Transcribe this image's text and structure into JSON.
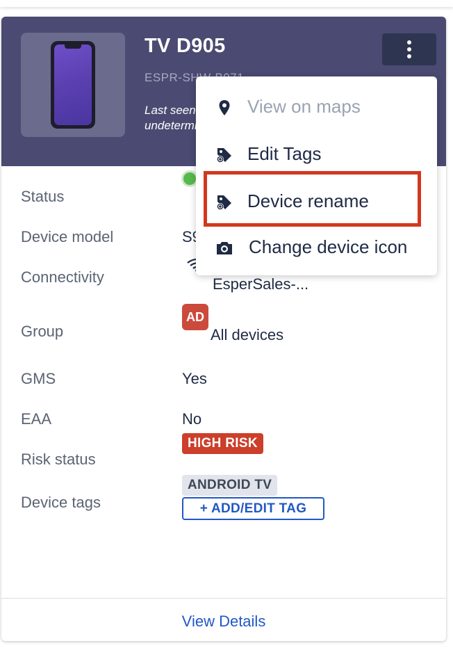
{
  "device": {
    "name": "TV D905",
    "serial": "ESPR-SHW-B071",
    "last_seen": "Last seen undetermined"
  },
  "details": {
    "status_label": "Status",
    "model_label": "Device model",
    "model_value": "S9",
    "connectivity_label": "Connectivity",
    "connectivity_value": "EsperSales-...",
    "group_label": "Group",
    "group_badge": "AD",
    "group_value": "All devices",
    "gms_label": "GMS",
    "gms_value": "Yes",
    "eaa_label": "EAA",
    "eaa_value": "No",
    "risk_label": "Risk status",
    "risk_value": "HIGH RISK",
    "tags_label": "Device tags",
    "tag": "ANDROID TV",
    "add_tag": "+ ADD/EDIT TAG"
  },
  "footer": {
    "view_details": "View Details"
  },
  "menu": {
    "items": [
      {
        "label": "View on maps",
        "icon": "map-pin-icon",
        "disabled": true
      },
      {
        "label": "Edit Tags",
        "icon": "tag-icon"
      },
      {
        "label": "Device rename",
        "icon": "tag-icon"
      },
      {
        "label": "Change device icon",
        "icon": "camera-icon"
      }
    ]
  },
  "colors": {
    "header_bg": "#4a4a72",
    "accent_blue": "#2158c4",
    "risk_red": "#cc3f2a",
    "highlight_red": "#d2381f",
    "status_green": "#57b84d"
  }
}
